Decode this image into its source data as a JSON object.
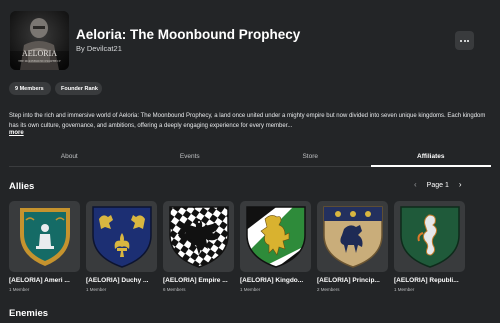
{
  "group": {
    "name": "Aeloria: The Moonbound Prophecy",
    "owner_prefix": "By ",
    "owner": "Devilcat21",
    "icon_text": "AELORIA",
    "icon_subtext": "THE MOONBOUND PROPHECY"
  },
  "badges": [
    "9 Members",
    "Founder Rank"
  ],
  "description": "Step into the rich and immersive world of Aeloria: The Moonbound Prophecy, a land once united under a mighty empire but now divided into seven unique kingdoms. Each kingdom has its own culture, governance, and ambitions, offering a deeply engaging experience for every member...",
  "more_label": "more",
  "tabs": [
    {
      "label": "About",
      "active": false
    },
    {
      "label": "Events",
      "active": false
    },
    {
      "label": "Store",
      "active": false
    },
    {
      "label": "Affiliates",
      "active": true
    }
  ],
  "allies": {
    "title": "Allies",
    "page_label": "Page 1",
    "prev_icon": "chevron-left-icon",
    "next_icon": "chevron-right-icon",
    "items": [
      {
        "name": "[AELORIA] Ameri ...",
        "members": "1 Member",
        "emblem": "teal-shield-figure"
      },
      {
        "name": "[AELORIA] Duchy ...",
        "members": "1 Member",
        "emblem": "blue-gold-lions-fleur"
      },
      {
        "name": "[AELORIA] Empire ...",
        "members": "6 Members",
        "emblem": "checkered-eagle"
      },
      {
        "name": "[AELORIA] Kingdo...",
        "members": "1 Member",
        "emblem": "green-gold-lion"
      },
      {
        "name": "[AELORIA] Princip...",
        "members": "2 Members",
        "emblem": "tan-horse-stars"
      },
      {
        "name": "[AELORIA] Republi...",
        "members": "1 Member",
        "emblem": "green-seahorse"
      }
    ]
  },
  "enemies": {
    "title": "Enemies"
  },
  "colors": {
    "background": "#232527",
    "card_background": "#393b3d",
    "badge_background": "#393b3d",
    "text": "#ffffff"
  }
}
